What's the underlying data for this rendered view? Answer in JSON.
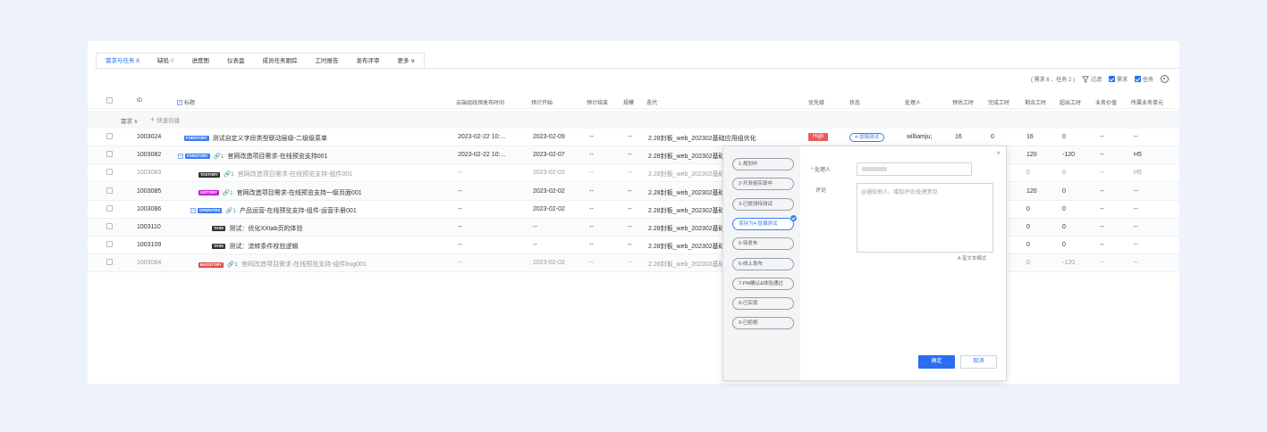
{
  "tabs": [
    {
      "label": "需求与任务 8",
      "count": ""
    },
    {
      "label": "缺陷",
      "count": "0"
    },
    {
      "label": "进度图",
      "count": ""
    },
    {
      "label": "仪表盘",
      "count": ""
    },
    {
      "label": "成员任务跟踪",
      "count": ""
    },
    {
      "label": "工时报告",
      "count": ""
    },
    {
      "label": "发布评审",
      "count": ""
    },
    {
      "label": "更多 ∨",
      "count": ""
    }
  ],
  "toolbar": {
    "summary": "( 需求 6 、任务 2 )",
    "filter": "过滤",
    "req": "需求",
    "task": "任务"
  },
  "columns": {
    "id": "ID",
    "title": "标题",
    "release_time": "云端组线预发布时间",
    "plan_start": "预计开始",
    "plan_end": "预计结束",
    "scale": "规模",
    "iteration": "迭代",
    "priority": "优先级",
    "status": "状态",
    "handler": "处理人",
    "est_hours": "预估工时",
    "done_hours": "完成工时",
    "remain_hours": "剩余工时",
    "over_hours": "超出工时",
    "biz_value": "业务价值",
    "biz_unit": "所属业务单元"
  },
  "group": {
    "label": "需求 ∨",
    "quick_add": "快速创建"
  },
  "rows": [
    {
      "id": "1003024",
      "tag": "FORSTORY",
      "link": "",
      "title": "测试自定义字段类型联动层级-二级级菜单",
      "release": "2023-02-22 10:...",
      "start": "2023-02-09",
      "end": "--",
      "scale": "--",
      "iter": "2.28封板_web_202302基础应用组优化",
      "priority": "High",
      "status": "4-冒烟测试",
      "handler": "williamju;",
      "est": "16",
      "done": "0",
      "remain": "16",
      "over": "0",
      "value": "--",
      "unit": "--"
    },
    {
      "id": "1003082",
      "tag": "FORSTORY",
      "link": "1",
      "title": "官网改造项目需求-在线预览支持001",
      "release": "2023-02-22 10:...",
      "start": "2023-02-07",
      "end": "--",
      "scale": "--",
      "iter": "2.28封板_web_202302基础",
      "priority": "",
      "status": "",
      "handler": "",
      "est": "",
      "done": "",
      "remain": "120",
      "over": "-120",
      "value": "--",
      "unit": "H5"
    },
    {
      "id": "1003083",
      "tag": "TASTORY",
      "link": "1",
      "title": "官网改造项目需求-在线预览支持-组件001",
      "release": "--",
      "start": "2023-02-02",
      "end": "--",
      "scale": "--",
      "iter": "2.28封板_web_202302基础",
      "priority": "",
      "status": "",
      "handler": "",
      "est": "",
      "done": "",
      "remain": "0",
      "over": "0",
      "value": "--",
      "unit": "H5"
    },
    {
      "id": "1003085",
      "tag": "UISTORY",
      "link": "1",
      "title": "官网改造项目需求-在线预览支持一级页面001",
      "release": "--",
      "start": "2023-02-02",
      "end": "--",
      "scale": "--",
      "iter": "2.28封板_web_202302基础",
      "priority": "",
      "status": "",
      "handler": "",
      "est": "",
      "done": "",
      "remain": "120",
      "over": "0",
      "value": "--",
      "unit": "--"
    },
    {
      "id": "1003086",
      "tag": "OPERATES",
      "link": "1",
      "title": "产品运营-在线预览支持-组件-运营手册001",
      "release": "--",
      "start": "2023-02-02",
      "end": "--",
      "scale": "--",
      "iter": "2.28封板_web_202302基础",
      "priority": "",
      "status": "",
      "handler": "",
      "est": "",
      "done": "",
      "remain": "0",
      "over": "0",
      "value": "--",
      "unit": "--"
    },
    {
      "id": "1003110",
      "tag": "TASK",
      "link": "",
      "title": "测试：优化XXtab页的体验",
      "release": "--",
      "start": "--",
      "end": "--",
      "scale": "--",
      "iter": "2.28封板_web_202302基础",
      "priority": "",
      "status": "",
      "handler": "",
      "est": "",
      "done": "",
      "remain": "0",
      "over": "0",
      "value": "--",
      "unit": "--"
    },
    {
      "id": "1003109",
      "tag": "TASK",
      "link": "",
      "title": "测试：流转条件校验逻辑",
      "release": "--",
      "start": "--",
      "end": "--",
      "scale": "--",
      "iter": "2.28封板_web_202302基础",
      "priority": "",
      "status": "",
      "handler": "",
      "est": "",
      "done": "",
      "remain": "0",
      "over": "0",
      "value": "--",
      "unit": "--"
    },
    {
      "id": "1003084",
      "tag": "BUGSTORY",
      "link": "1",
      "title": "官网改造项目需求-在线预览支持-组件bug001",
      "release": "--",
      "start": "2023-02-02",
      "end": "--",
      "scale": "--",
      "iter": "2.28封板_web_202302基础",
      "priority": "",
      "status": "",
      "handler": "",
      "est": "",
      "done": "",
      "remain": "0",
      "over": "-120",
      "value": "--",
      "unit": "--"
    }
  ],
  "popup": {
    "steps": [
      "1-规划中",
      "2-开发组实现中",
      "3-已提测待测试",
      "保持为4-冒烟测试",
      "5-待发布",
      "6-线上发布",
      "7-PM确认&体验通过",
      "8-已实现",
      "9-已拒绝"
    ],
    "selected_step": 3,
    "handler_label": "处理人",
    "comment_label": "评论",
    "comment_placeholder": "@通知他人，增加评论/处理意见",
    "rich_text": "富文本模式",
    "ok": "确定",
    "cancel": "取消",
    "close": "×"
  }
}
